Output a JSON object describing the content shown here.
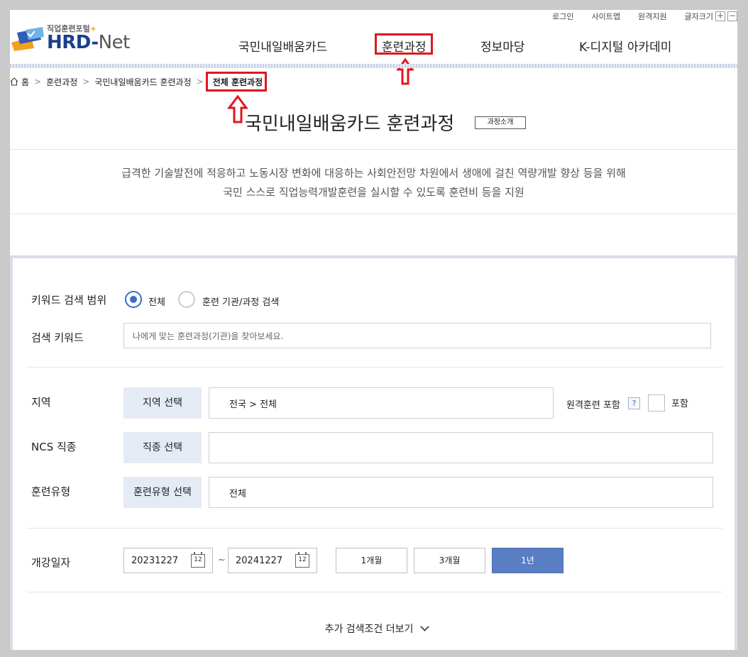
{
  "utility": {
    "login": "로그인",
    "sitemap": "사이트맵",
    "remote_support": "원격지원",
    "font_size": "글자크기",
    "plus": "+",
    "minus": "−"
  },
  "logo": {
    "sub": "직업훈련포털",
    "plus": "+",
    "brand": "HRD-",
    "net": "Net"
  },
  "gnb": [
    "국민내일배움카드",
    "훈련과정",
    "정보마당",
    "K-디지털 아카데미"
  ],
  "breadcrumb": {
    "home": "홈",
    "sep": ">",
    "items": [
      "훈련과정",
      "국민내일배움카드 훈련과정",
      "전체 훈련과정"
    ]
  },
  "page": {
    "title": "국민내일배움카드 훈련과정",
    "intro_button": "과정소개",
    "desc_line1": "급격한 기술발전에 적응하고 노동시장 변화에 대응하는 사회안전망 차원에서 생애에 걸친 역량개발 향상 등을 위해",
    "desc_line2": "국민 스스로 직업능력개발훈련을 실시할 수 있도록 훈련비 등을 지원"
  },
  "search": {
    "keyword_scope_label": "키워드 검색 범위",
    "scope_options": [
      "전체",
      "훈련 기관/과정 검색"
    ],
    "keyword_label": "검색 키워드",
    "keyword_placeholder": "나에게 맞는 훈련과정(기관)을 찾아보세요.",
    "region_label": "지역",
    "region_button": "지역 선택",
    "region_value": "전국 > 전체",
    "remote_label": "원격훈련 포함",
    "help": "?",
    "include_label": "포함",
    "ncs_label": "NCS 직종",
    "ncs_button": "직종 선택",
    "type_label": "훈련유형",
    "type_button": "훈련유형 선택",
    "type_value": "전체",
    "date_label": "개강일자",
    "start_date": "20231227",
    "end_date": "20241227",
    "tilde": "~",
    "cal": "12",
    "periods": [
      "1개월",
      "3개월",
      "1년"
    ],
    "more": "추가 검색조건 더보기"
  },
  "colors": {
    "highlight": "#e0161f",
    "accent": "#5a7ec4",
    "brand": "#1a3e8e"
  }
}
